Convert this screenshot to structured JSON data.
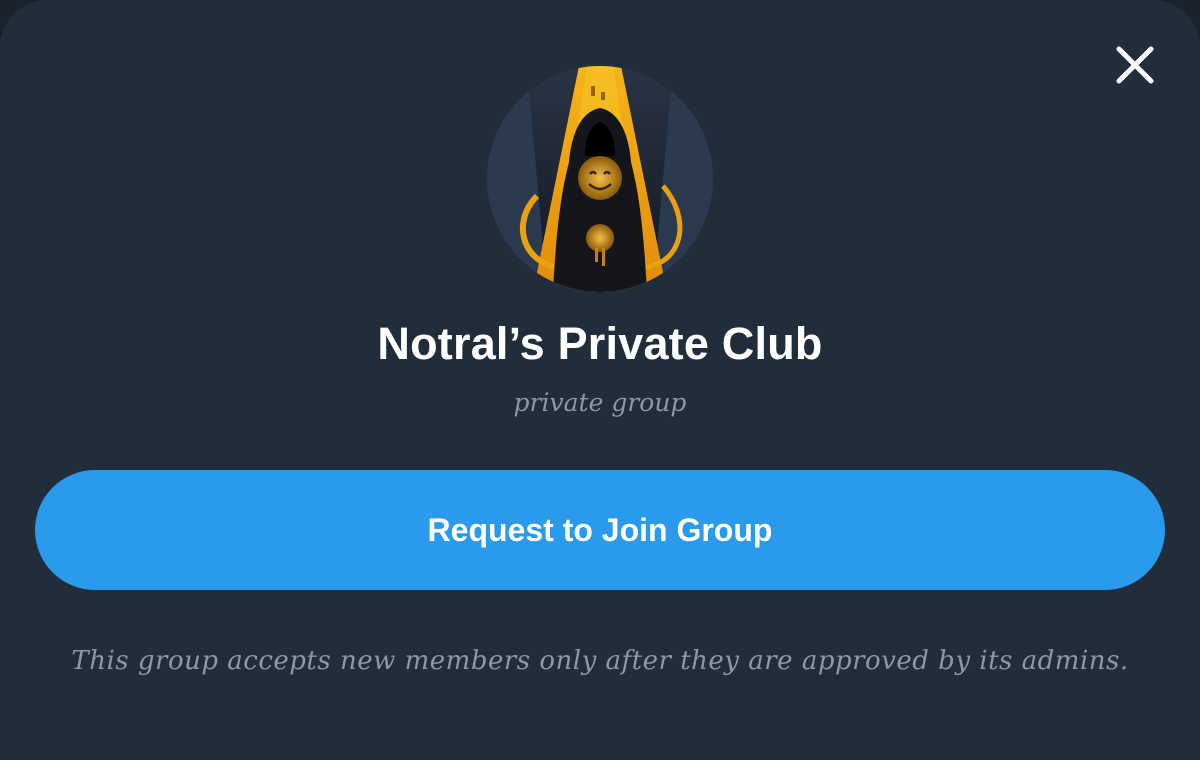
{
  "dialog": {
    "close_icon": "close-icon",
    "group_name": "Notral’s Private Club",
    "group_type": "private group",
    "avatar_icon": "hooded-figure-avatar",
    "join_button_label": "Request to Join Group",
    "note": "This group accepts new members only after they are approved by its admins."
  },
  "colors": {
    "background": "#212d3b",
    "accent": "#2a9bec",
    "text_primary": "#ffffff",
    "text_secondary": "#8b98a8"
  }
}
